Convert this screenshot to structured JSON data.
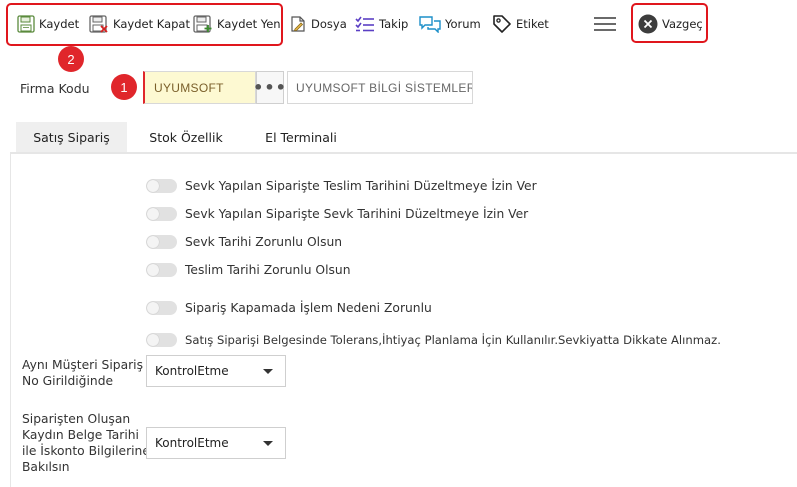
{
  "toolbar": {
    "kaydet": "Kaydet",
    "kaydet_kapat": "Kaydet Kapat",
    "kaydet_yeni": "Kaydet Yeni",
    "dosya": "Dosya",
    "takip": "Takip",
    "yorum": "Yorum",
    "etiket": "Etiket",
    "vazgec": "Vazgeç"
  },
  "badges": {
    "one": "1",
    "two": "2"
  },
  "firma": {
    "label": "Firma Kodu",
    "code": "UYUMSOFT",
    "lookup": "•••",
    "name": "UYUMSOFT BİLGİ SİSTEMLERİ VE"
  },
  "tabs": [
    {
      "label": "Satış Sipariş"
    },
    {
      "label": "Stok Özellik"
    },
    {
      "label": "El Terminali"
    }
  ],
  "toggles": [
    {
      "label": "Sevk Yapılan Siparişte Teslim Tarihini Düzeltmeye İzin Ver"
    },
    {
      "label": "Sevk Yapılan Siparişte Sevk Tarihini Düzeltmeye İzin Ver"
    },
    {
      "label": "Sevk Tarihi Zorunlu Olsun"
    },
    {
      "label": "Teslim Tarihi Zorunlu Olsun"
    },
    {
      "label": "Sipariş Kapamada İşlem Nedeni Zorunlu"
    },
    {
      "label": "Satış Siparişi Belgesinde Tolerans,İhtiyaç Planlama İçin Kullanılır.Sevkiyatta Dikkate Alınmaz."
    }
  ],
  "selects": [
    {
      "label_lines": [
        "Aynı Müşteri Sipariş",
        "No Girildiğinde"
      ],
      "value": "KontrolEtme"
    },
    {
      "label_lines": [
        "Siparişten Oluşan",
        "Kaydın Belge Tarihi",
        "ile İskonto Bilgilerine",
        "Bakılsın"
      ],
      "value": "KontrolEtme"
    }
  ],
  "colors": {
    "highlight": "#e0161d",
    "accent": "#5b3fc4",
    "teal": "#1c8fc9"
  }
}
